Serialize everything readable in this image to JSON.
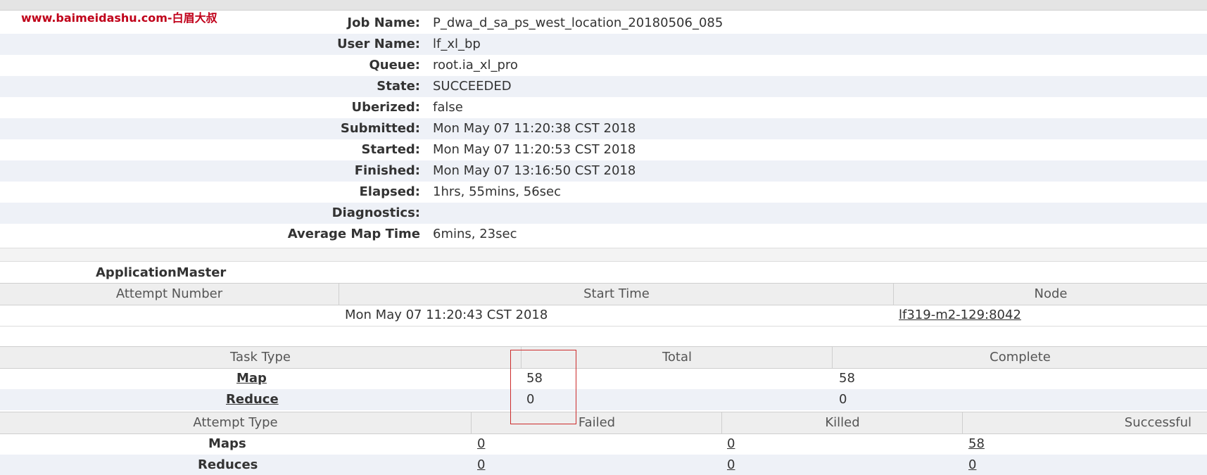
{
  "watermark": "www.baimeidashu.com-白眉大叔",
  "job": {
    "rows": [
      {
        "label": "Job Name:",
        "value": "P_dwa_d_sa_ps_west_location_20180506_085"
      },
      {
        "label": "User Name:",
        "value": "lf_xl_bp"
      },
      {
        "label": "Queue:",
        "value": "root.ia_xl_pro"
      },
      {
        "label": "State:",
        "value": "SUCCEEDED"
      },
      {
        "label": "Uberized:",
        "value": "false"
      },
      {
        "label": "Submitted:",
        "value": "Mon May 07 11:20:38 CST 2018"
      },
      {
        "label": "Started:",
        "value": "Mon May 07 11:20:53 CST 2018"
      },
      {
        "label": "Finished:",
        "value": "Mon May 07 13:16:50 CST 2018"
      },
      {
        "label": "Elapsed:",
        "value": "1hrs, 55mins, 56sec"
      },
      {
        "label": "Diagnostics:",
        "value": ""
      },
      {
        "label": "Average Map Time",
        "value": "6mins, 23sec"
      }
    ]
  },
  "am": {
    "title": "ApplicationMaster",
    "headers": {
      "attempt": "Attempt Number",
      "start": "Start Time",
      "node": "Node"
    },
    "row": {
      "start": "Mon May 07 11:20:43 CST 2018",
      "node": "lf319-m2-129:8042"
    }
  },
  "tasks": {
    "headers": {
      "type": "Task Type",
      "total": "Total",
      "complete": "Complete"
    },
    "map": {
      "label": "Map",
      "total": "58",
      "complete": "58"
    },
    "reduce": {
      "label": "Reduce",
      "total": "0",
      "complete": "0"
    }
  },
  "attempts": {
    "headers": {
      "type": "Attempt Type",
      "failed": "Failed",
      "killed": "Killed",
      "successful": "Successful"
    },
    "maps": {
      "label": "Maps",
      "failed": "0",
      "killed": "0",
      "successful": "58"
    },
    "reduces": {
      "label": "Reduces",
      "failed": "0",
      "killed": "0",
      "successful": "0"
    }
  },
  "colors": {
    "highlight_box": "#cc2b2b",
    "watermark": "#c0001a",
    "alt_row": "#eef1f7"
  }
}
